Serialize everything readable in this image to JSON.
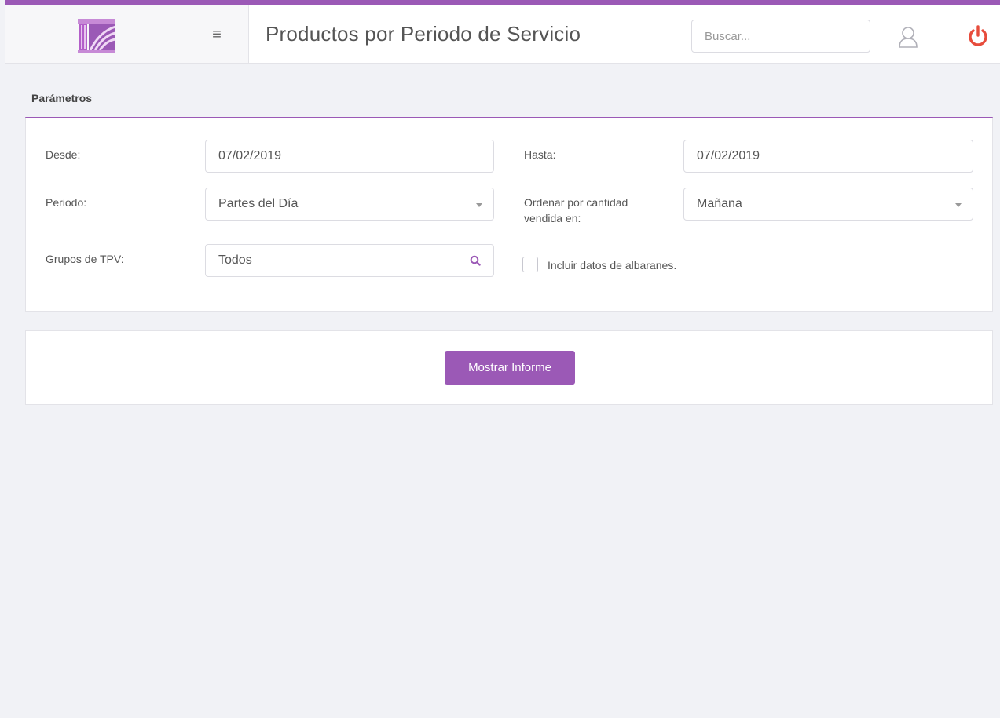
{
  "header": {
    "title": "Productos por Periodo de Servicio",
    "search_placeholder": "Buscar..."
  },
  "params": {
    "section_title": "Parámetros",
    "desde": {
      "label": "Desde:",
      "value": "07/02/2019"
    },
    "hasta": {
      "label": "Hasta:",
      "value": "07/02/2019"
    },
    "periodo": {
      "label": "Periodo:",
      "value": "Partes del Día"
    },
    "ordenar": {
      "label_line1": "Ordenar por cantidad",
      "label_line2": "vendida en:",
      "value": "Mañana"
    },
    "grupos": {
      "label": "Grupos de TPV:",
      "value": "Todos"
    },
    "albaranes": {
      "label": "Incluir datos de albaranes.",
      "checked": false
    }
  },
  "actions": {
    "show_report": "Mostrar Informe"
  },
  "colors": {
    "accent": "#9b59b6",
    "power": "#e74c3c",
    "background": "#f1f2f6"
  },
  "icons": {
    "menu": "hamburger-menu-icon",
    "user": "user-icon",
    "power": "power-icon",
    "search": "search-icon",
    "logo": "logo-icon"
  }
}
